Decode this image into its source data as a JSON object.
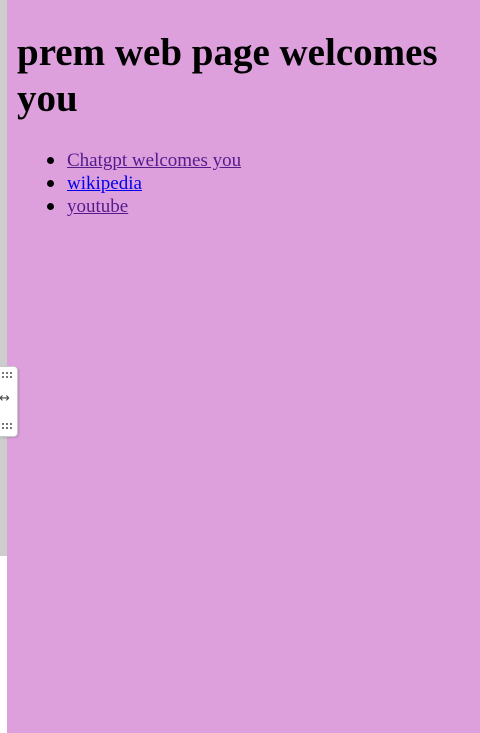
{
  "page": {
    "heading": "prem web page welcomes you",
    "links": [
      {
        "label": "Chatgpt welcomes you",
        "state": "visited"
      },
      {
        "label": "wikipedia",
        "state": "unvisited"
      },
      {
        "label": "youtube",
        "state": "visited"
      }
    ],
    "background_color": "#dda0dd"
  },
  "side_handle": {
    "top_icon": "grip-dots-icon",
    "middle_glyph": "↔",
    "bottom_icon": "grip-dots-icon"
  }
}
